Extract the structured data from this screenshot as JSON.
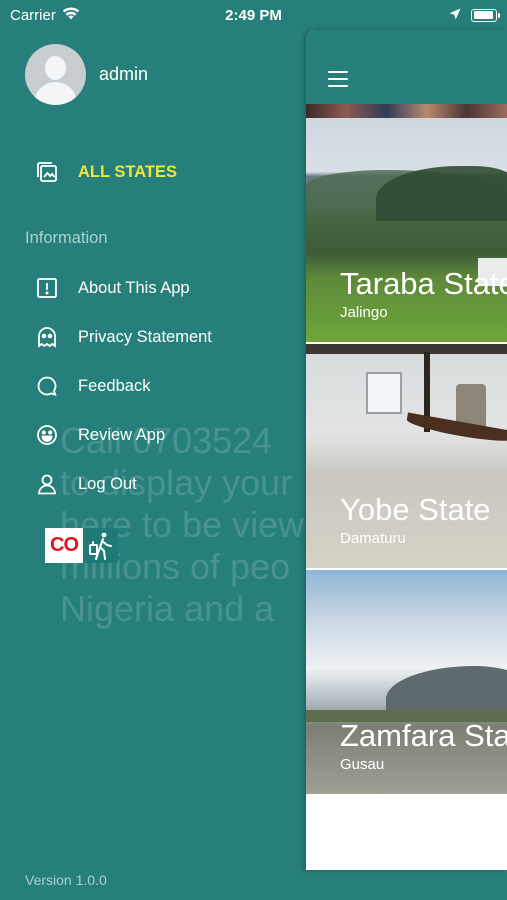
{
  "status_bar": {
    "carrier": "Carrier",
    "time": "2:49 PM"
  },
  "background_ad_text": [
    "Call 0703524",
    "to display your",
    "here to be view",
    "millions of peo",
    "Nigeria and a"
  ],
  "drawer": {
    "username": "admin",
    "all_states_label": "ALL STATES",
    "section_title": "Information",
    "items": [
      {
        "label": "About This App",
        "icon": "exclamation-box-icon"
      },
      {
        "label": "Privacy Statement",
        "icon": "ghost-icon"
      },
      {
        "label": "Feedback",
        "icon": "chat-bubble-icon"
      },
      {
        "label": "Review App",
        "icon": "smiley-icon"
      },
      {
        "label": "Log Out",
        "icon": "user-icon"
      }
    ],
    "ad_logo_text": "CO",
    "version": "Version 1.0.0"
  },
  "main": {
    "cards": [
      {
        "name": "Taraba State",
        "capital": "Jalingo"
      },
      {
        "name": "Yobe State",
        "capital": "Damaturu"
      },
      {
        "name": "Zamfara State",
        "capital": "Gusau"
      }
    ]
  },
  "colors": {
    "primary": "#267f7b",
    "active_label": "#f2e53b",
    "section_title": "#a8d2cf"
  }
}
